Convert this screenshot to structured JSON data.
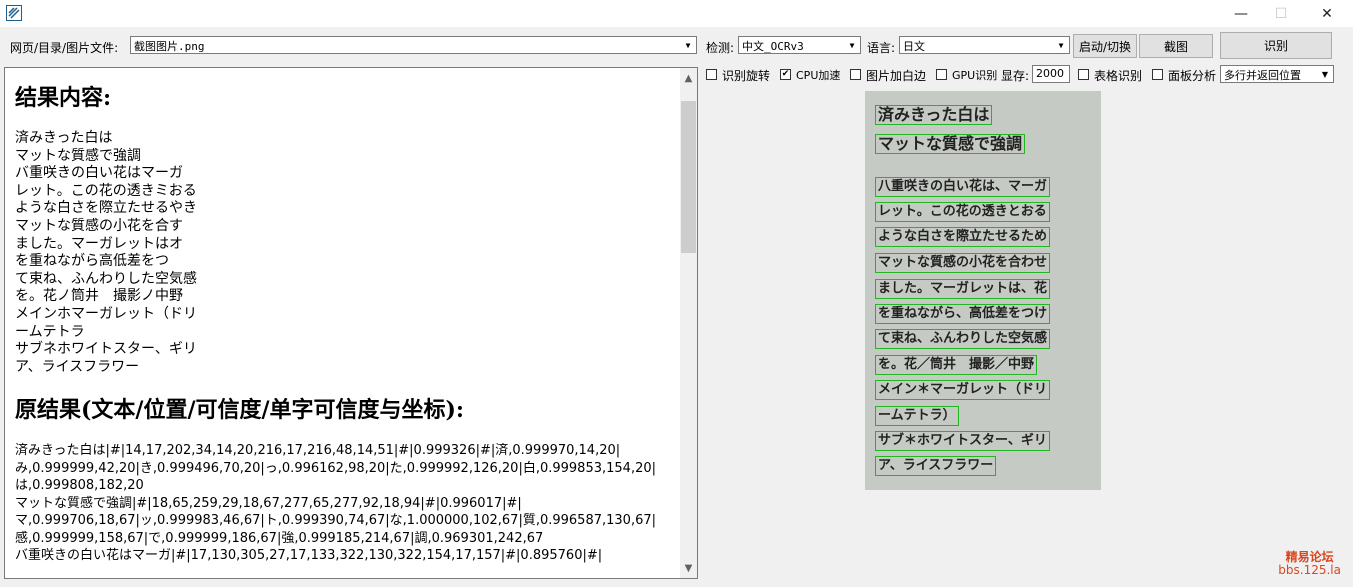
{
  "window": {
    "title": "",
    "minimize_icon": "minimize-icon",
    "maximize_icon": "maximize-icon",
    "close_icon": "close-icon",
    "minimize_glyph": "—",
    "maximize_glyph": "☐",
    "close_glyph": "✕"
  },
  "toolbar": {
    "file_label": "网页/目录/图片文件:",
    "file_value": "截图图片.png",
    "detect_label": "检测:",
    "detect_value": "中文_OCRv3",
    "lang_label": "语言:",
    "lang_value": "日文",
    "start_switch": "启动/切换",
    "screenshot": "截图",
    "recognize": "识别"
  },
  "options": {
    "rotate": {
      "label": "识别旋转",
      "checked": false
    },
    "cpu": {
      "label": "CPU加速",
      "checked": true
    },
    "border": {
      "label": "图片加白边",
      "checked": false
    },
    "gpu": {
      "label": "GPU识别",
      "checked": false
    },
    "vram_label": "显存:",
    "vram_value": "2000",
    "table": {
      "label": "表格识别",
      "checked": false
    },
    "panel": {
      "label": "面板分析",
      "checked": false
    },
    "return_mode": "多行并返回位置"
  },
  "result": {
    "heading": "结果内容:",
    "lines": [
      "済みきった白は",
      "マットな質感で強調",
      "バ重咲きの白い花はマーガ",
      "レット。この花の透きミおる",
      "ような白さを際立たせるやき",
      "マットな質感の小花を合す",
      "ました。マーガレットはオ",
      "を重ねながら高低差をつ",
      "て束ね、ふんわりした空気感",
      "を。花ノ筒井　撮影ノ中野",
      "メインホマーガレット（ドリ",
      "ームテトラ",
      "サブネホワイトスター、ギリ",
      "ア、ライスフラワー"
    ],
    "raw_heading": "原结果(文本/位置/可信度/单字可信度与坐标):",
    "raw_lines": [
      "済みきった白は|#|14,17,202,34,14,20,216,17,216,48,14,51|#|0.999326|#|済,0.999970,14,20|",
      "み,0.999999,42,20|き,0.999496,70,20|っ,0.996162,98,20|た,0.999992,126,20|白,0.999853,154,20|",
      "は,0.999808,182,20",
      "マットな質感で強調|#|18,65,259,29,18,67,277,65,277,92,18,94|#|0.996017|#|",
      "マ,0.999706,18,67|ッ,0.999983,46,67|ト,0.999390,74,67|な,1.000000,102,67|質,0.996587,130,67|",
      "感,0.999999,158,67|で,0.999999,186,67|強,0.999185,214,67|調,0.969301,242,67",
      "バ重咲きの白い花はマーガ|#|17,130,305,27,17,133,322,130,322,154,17,157|#|0.895760|#|"
    ]
  },
  "preview": {
    "lines": [
      "済みきった白は",
      "マットな質感で強調",
      "八重咲きの白い花は、マーガ",
      "レット。この花の透きとおる",
      "ような白さを際立たせるため",
      "マットな質感の小花を合わせ",
      "ました。マーガレットは、花",
      "を重ねながら、高低差をつけ",
      "て束ね、ふんわりした空気感",
      "を。花／筒井　撮影／中野",
      "メイン＊マーガレット（ドリ",
      "ームテトラ）",
      "サブ＊ホワイトスター、ギリ",
      "ア、ライスフラワー"
    ]
  },
  "watermark": {
    "line1": "精易论坛",
    "line2": "bbs.125.la"
  },
  "colors": {
    "box_green": "#23b623",
    "watermark": "#d84820"
  }
}
